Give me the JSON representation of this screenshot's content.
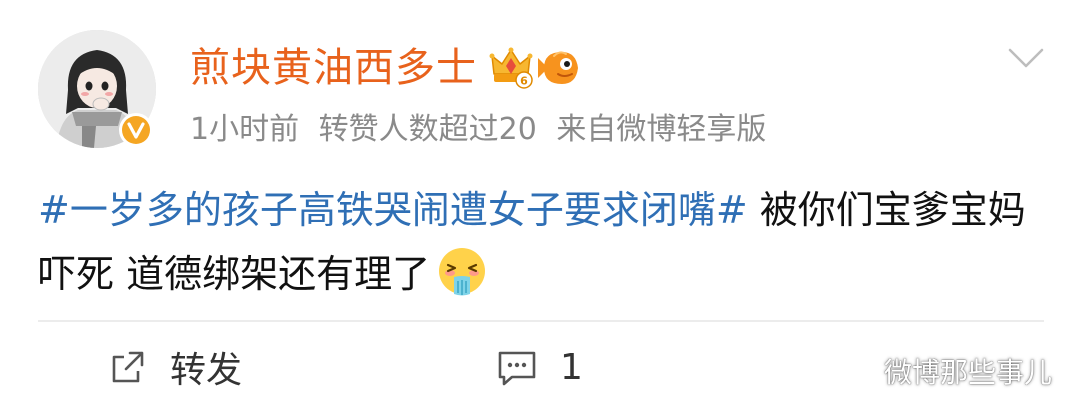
{
  "post": {
    "author": {
      "name": "煎块黄油西多士",
      "crown_badge_level": "6",
      "verified": true
    },
    "meta": {
      "time": "1小时前",
      "reposts_note": "转赞人数超过20",
      "source": "来自微博轻享版"
    },
    "content": {
      "hashtag": "#一岁多的孩子高铁哭闹遭女子要求闭嘴#",
      "text": " 被你们宝爹宝妈吓死 道德绑架还有理了"
    },
    "actions": {
      "forward_label": "转发",
      "comment_count": "1",
      "like_count": ""
    },
    "watermark": "微博那些事儿"
  },
  "colors": {
    "username": "#e8621c",
    "hashtag": "#2f6fb5",
    "meta": "#8a8a8a",
    "verified_badge": "#f5a623"
  }
}
